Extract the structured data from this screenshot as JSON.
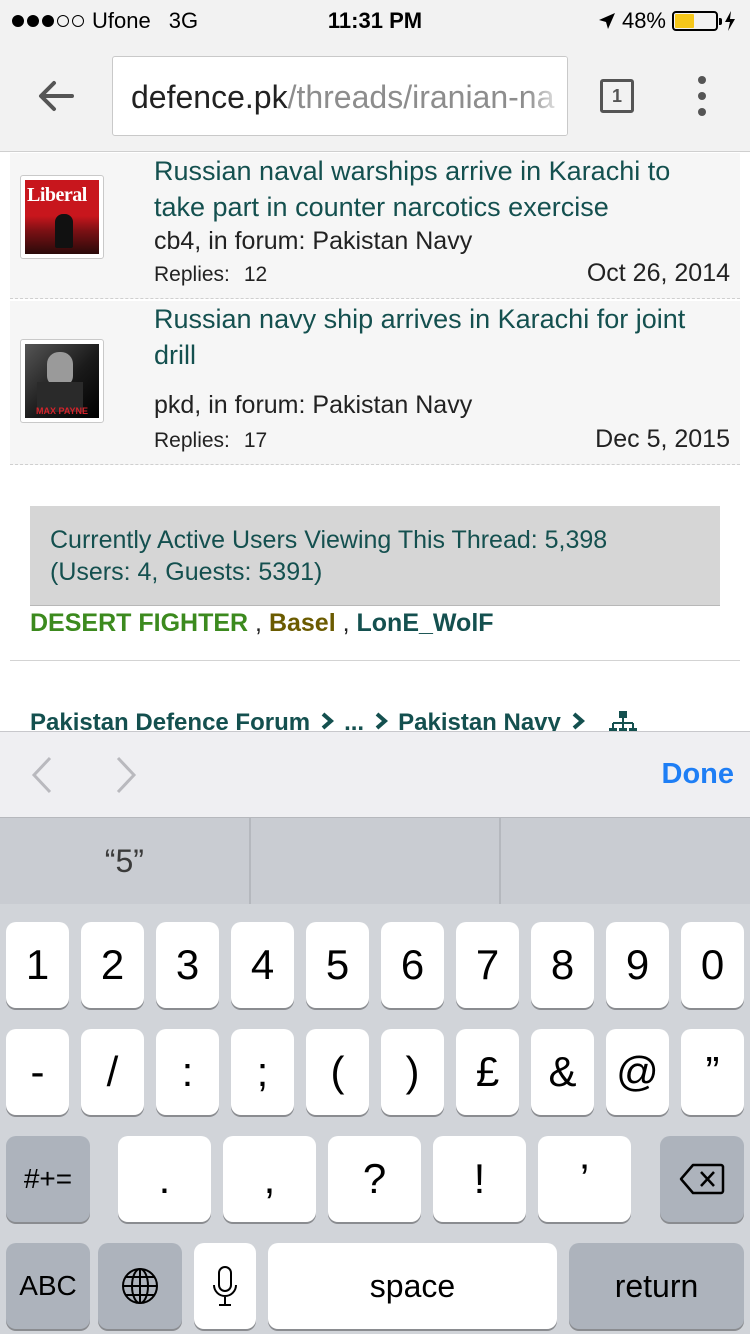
{
  "status_bar": {
    "carrier": "Ufone",
    "network": "3G",
    "time": "11:31 PM",
    "battery_percent": "48%",
    "battery_level": 0.48,
    "signal_bars_filled": 3,
    "signal_bars_total": 5
  },
  "browser": {
    "url_domain": "defence.pk",
    "url_path": "/threads/iranian-na",
    "tab_count": "1"
  },
  "threads": [
    {
      "title": "Russian naval warships arrive in Karachi to take part in counter narcotics exercise",
      "meta": "cb4, in forum: Pakistan Navy",
      "replies_label": "Replies:",
      "replies_count": "12",
      "date": "Oct 26, 2014",
      "avatar_text": "Liberal"
    },
    {
      "title": "Russian navy ship arrives in Karachi for joint drill",
      "meta": "pkd, in forum: Pakistan Navy",
      "replies_label": "Replies:",
      "replies_count": "17",
      "date": "Dec 5, 2015",
      "avatar_text": "MAX PAYNE"
    }
  ],
  "active": {
    "line1": "Currently Active Users Viewing This Thread: 5,398",
    "line2": "(Users: 4, Guests: 5391)",
    "users": [
      "DESERT FIGHTER",
      "Basel",
      "LonE_WolF"
    ],
    "separator": ","
  },
  "breadcrumb": {
    "items": [
      "Pakistan Defence Forum",
      "...",
      "Pakistan Navy"
    ]
  },
  "accessory": {
    "done_label": "Done"
  },
  "keyboard": {
    "predictions": [
      "“5”",
      "",
      ""
    ],
    "row1": [
      "1",
      "2",
      "3",
      "4",
      "5",
      "6",
      "7",
      "8",
      "9",
      "0"
    ],
    "row2": [
      "-",
      "/",
      ":",
      ";",
      "(",
      ")",
      "£",
      "&",
      "@",
      "”"
    ],
    "row3": {
      "symbols_key": "#+=",
      "keys": [
        ".",
        ",",
        "?",
        "!",
        "’"
      ]
    },
    "row4": {
      "abc_key": "ABC",
      "space_key": "space",
      "return_key": "return"
    }
  },
  "colors": {
    "link": "#14504f",
    "accent_blue": "#1e7ef5",
    "user_green": "#3c8a1e",
    "user_olive": "#6b5b00",
    "battery": "#f5c71a"
  },
  "icons": [
    "back-arrow-icon",
    "tabs-icon",
    "overflow-menu-icon",
    "location-arrow-icon",
    "battery-icon",
    "charging-bolt-icon",
    "sitemap-icon",
    "chevron-left-icon",
    "chevron-right-icon",
    "globe-icon",
    "microphone-icon",
    "backspace-icon"
  ]
}
